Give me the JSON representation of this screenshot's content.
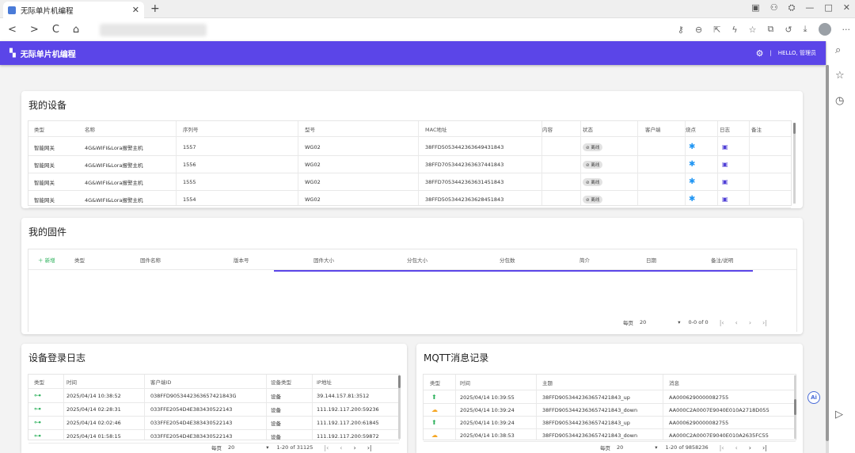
{
  "browser": {
    "tab_title": "无际单片机编程",
    "tab_close": "✕",
    "new_tab": "+",
    "nav": {
      "back": "<",
      "forward": ">",
      "reload": "C",
      "home": "⌂"
    },
    "window": {
      "minimize": "—",
      "maximize": "□",
      "close": "✕"
    },
    "more": "···"
  },
  "app": {
    "title": "无际单片机编程",
    "separator": "|",
    "greeting": "HELLO, 管理员"
  },
  "devices": {
    "title": "我的设备",
    "columns": [
      "类型",
      "名称",
      "序列号",
      "型号",
      "MAC地址",
      "内容",
      "状态",
      "客户端",
      "烧点",
      "日志",
      "备注"
    ],
    "rows": [
      {
        "type": "智能网关",
        "name": "4G&WIFI&Lora报警主机",
        "serial": "1557",
        "model": "WG02",
        "mac": "38FFD5053442363649431843",
        "status": "离线"
      },
      {
        "type": "智能网关",
        "name": "4G&WIFI&Lora报警主机",
        "serial": "1556",
        "model": "WG02",
        "mac": "38FFD7053442363637441843",
        "status": "离线"
      },
      {
        "type": "智能网关",
        "name": "4G&WIFI&Lora报警主机",
        "serial": "1555",
        "model": "WG02",
        "mac": "38FFD7053442363631451843",
        "status": "离线"
      },
      {
        "type": "智能网关",
        "name": "4G&WIFI&Lora报警主机",
        "serial": "1554",
        "model": "WG02",
        "mac": "38FFD5053442363628451843",
        "status": "离线"
      }
    ]
  },
  "firmware": {
    "title": "我的固件",
    "add": "＋ 新增",
    "columns": [
      "类型",
      "固件名称",
      "版本号",
      "固件大小",
      "分包大小",
      "分包数",
      "简介",
      "日期",
      "备注/说明"
    ],
    "pager": {
      "label": "每页",
      "size": "20",
      "range": "0-0 of 0"
    }
  },
  "login_log": {
    "title": "设备登录日志",
    "columns": [
      "类型",
      "时间",
      "客户端ID",
      "设备类型",
      "IP地址"
    ],
    "rows": [
      {
        "time": "2025/04/14 10:38:52",
        "client": "038FFD9053442363657421843G",
        "dtype": "设备",
        "ip": "39.144.157.81:3512"
      },
      {
        "time": "2025/04/14 02:28:31",
        "client": "033FFE2054D4E383430522143",
        "dtype": "设备",
        "ip": "111.192.117.200:59236"
      },
      {
        "time": "2025/04/14 02:02:46",
        "client": "033FFE2054D4E383430522143",
        "dtype": "设备",
        "ip": "111.192.117.200:61845"
      },
      {
        "time": "2025/04/14 01:58:15",
        "client": "033FFE2054D4E383430522143",
        "dtype": "设备",
        "ip": "111.192.117.200:59872"
      }
    ],
    "pager": {
      "label": "每页",
      "size": "20",
      "range": "1-20 of 31125"
    }
  },
  "mqtt": {
    "title": "MQTT消息记录",
    "columns": [
      "类型",
      "时间",
      "主题",
      "消息"
    ],
    "rows": [
      {
        "kind": "up",
        "time": "2025/04/14 10:39:55",
        "topic": "38FFD9053442363657421843_up",
        "msg": "AA0006290000082755"
      },
      {
        "kind": "down",
        "time": "2025/04/14 10:39:24",
        "topic": "38FFD9053442363657421843_down",
        "msg": "AA000C2A0007E9040E010A2718D055"
      },
      {
        "kind": "up",
        "time": "2025/04/14 10:39:24",
        "topic": "38FFD9053442363657421843_up",
        "msg": "AA0006290000082755"
      },
      {
        "kind": "down",
        "time": "2025/04/14 10:38:53",
        "topic": "38FFD9053442363657421843_down",
        "msg": "AA000C2A0007E9040E010A2635FC55"
      }
    ],
    "pager": {
      "label": "每页",
      "size": "20",
      "range": "1-20 of 9858236"
    }
  },
  "colors": {
    "appbar": "#5b45e8",
    "accent": "#4f3fd6",
    "online": "#2bb05a",
    "down": "#f5a623"
  },
  "icons": {
    "link": "link-icon",
    "burst": "asterisk-icon",
    "calendar": "calendar-icon",
    "upload": "upload-arrow-icon",
    "cloud": "cloud-download-icon"
  }
}
